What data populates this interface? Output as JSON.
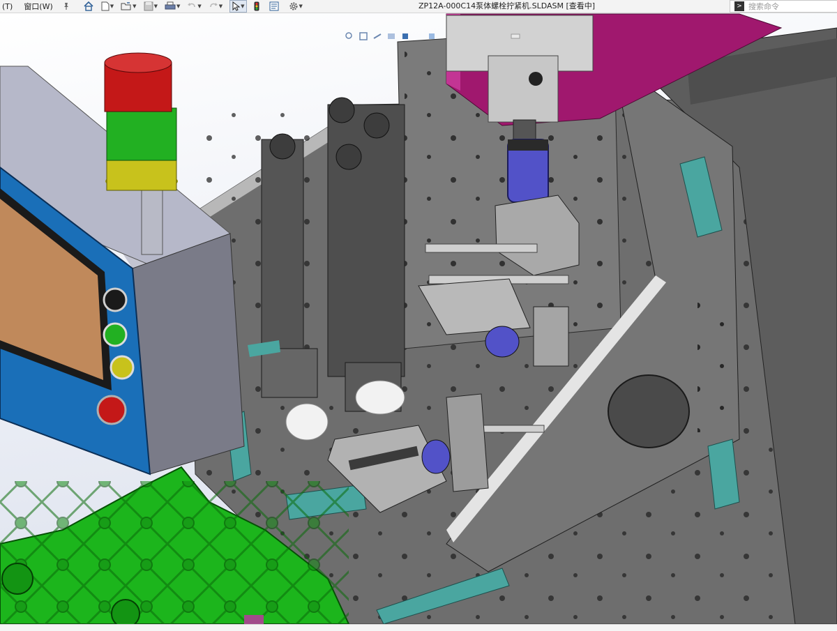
{
  "menu": {
    "tools_label": "(T)",
    "window_label": "窗口(W)"
  },
  "document": {
    "title": "ZP12A-000C14泵体螺栓拧紧机.SLDASM [查看中]"
  },
  "search": {
    "placeholder": "搜索命令"
  },
  "colors": {
    "plate_gray": "#6e6e6e",
    "frame_magenta": "#a0186e",
    "casting_green": "#1cb51c",
    "rail_teal": "#4aa6a0",
    "panel_blue": "#1a6fb8",
    "screen_orange": "#c0895b",
    "cylinder_blue": "#5252c8",
    "stack_red": "#c41818",
    "stack_green": "#22b022",
    "stack_yellow": "#c8c21c"
  },
  "icons": {
    "pin": "pin-icon",
    "home": "home-icon",
    "new": "new-document-icon",
    "open": "open-folder-icon",
    "save": "save-icon",
    "print": "print-icon",
    "undo": "undo-icon",
    "redo": "redo-icon",
    "select": "select-arrow-icon",
    "rebuild": "traffic-light-icon",
    "file_props": "file-properties-icon",
    "options": "gear-icon",
    "command": "command-prompt-icon"
  }
}
